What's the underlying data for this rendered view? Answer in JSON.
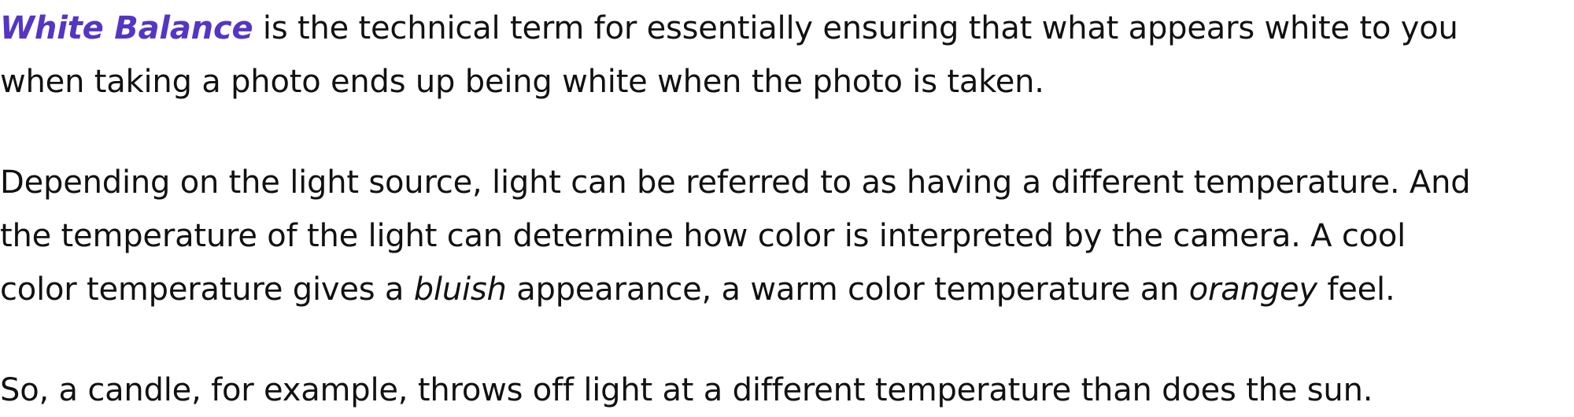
{
  "paragraph_1": {
    "term": "White Balance",
    "line1_rest": " is the technical term for essentially ensuring that what appears white to you",
    "line2": "when taking a photo ends up being white when the photo is taken."
  },
  "paragraph_2": {
    "line1": "Depending on the light source, light can be referred to as having a different temperature. And",
    "line2": "the temperature of the light can determine how color is interpreted by the camera. A cool",
    "line3_start": "color temperature gives a ",
    "em1": "bluish",
    "line3_mid": " appearance, a warm color temperature an ",
    "em2": "orangey",
    "line3_end": " feel."
  },
  "paragraph_3": {
    "line1": "So, a candle, for example, throws off light at a different temperature than does the sun."
  },
  "colors": {
    "term": "#5535c4",
    "text": "#111111",
    "background": "#ffffff"
  }
}
